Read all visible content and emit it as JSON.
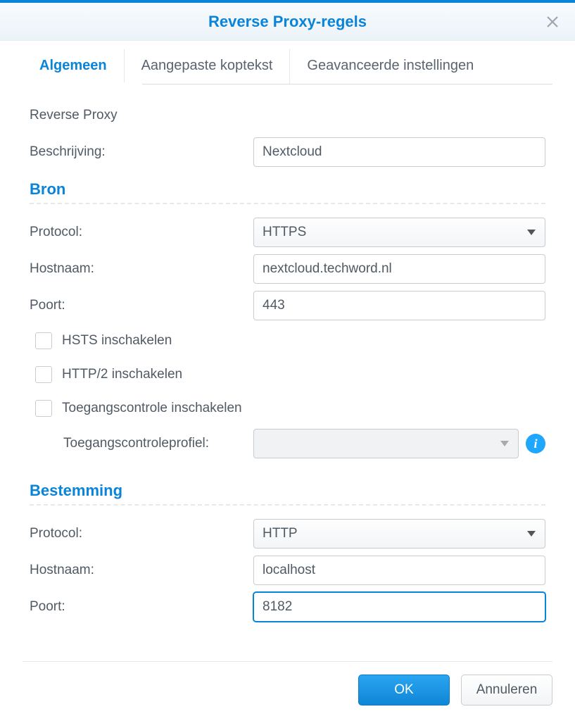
{
  "window": {
    "title": "Reverse Proxy-regels"
  },
  "tabs": {
    "general": "Algemeen",
    "custom_header": "Aangepaste koptekst",
    "advanced": "Geavanceerde instellingen"
  },
  "labels": {
    "reverse_proxy_heading": "Reverse Proxy",
    "description": "Beschrijving:",
    "protocol": "Protocol:",
    "hostname": "Hostnaam:",
    "port": "Poort:",
    "enable_hsts": "HSTS inschakelen",
    "enable_http2": "HTTP/2 inschakelen",
    "enable_access_control": "Toegangscontrole inschakelen",
    "access_control_profile": "Toegangscontroleprofiel:"
  },
  "sections": {
    "source": "Bron",
    "destination": "Bestemming"
  },
  "values": {
    "description": "Nextcloud",
    "source_protocol": "HTTPS",
    "source_hostname": "nextcloud.techword.nl",
    "source_port": "443",
    "access_profile": "",
    "dest_protocol": "HTTP",
    "dest_hostname": "localhost",
    "dest_port": "8182"
  },
  "buttons": {
    "ok": "OK",
    "cancel": "Annuleren"
  }
}
